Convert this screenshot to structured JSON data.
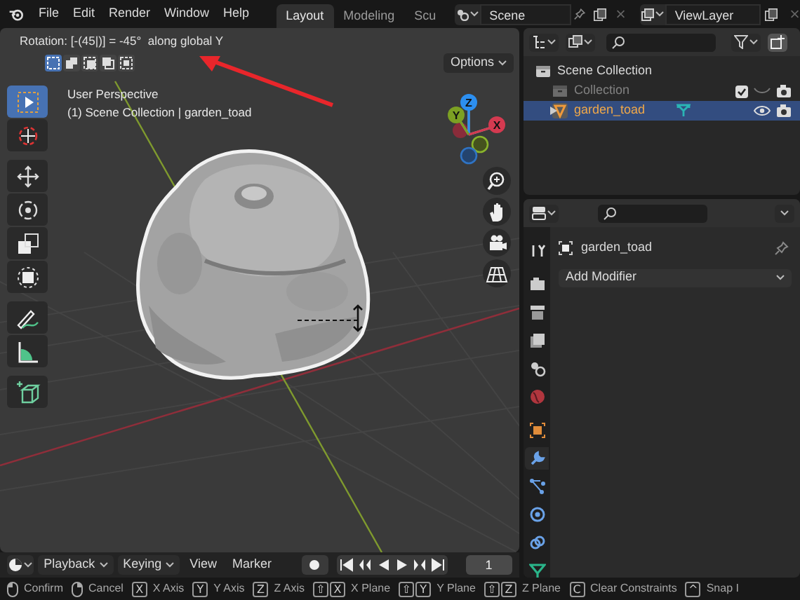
{
  "top_bar": {
    "menus": [
      "File",
      "Edit",
      "Render",
      "Window",
      "Help"
    ],
    "workspace_tabs": [
      {
        "label": "Layout",
        "selected": true
      },
      {
        "label": "Modeling",
        "selected": false
      },
      {
        "label": "Scu",
        "selected": false
      }
    ],
    "scene": "Scene",
    "view_layer": "ViewLayer"
  },
  "viewport": {
    "operator_text": "Rotation: [-(45|)] = -45°  along global Y",
    "select_modes": [
      {
        "selected": true
      },
      {
        "selected": false
      },
      {
        "selected": false
      },
      {
        "selected": false
      },
      {
        "selected": false
      }
    ],
    "options": "Options",
    "view_name": "User Perspective",
    "collection_info": "(1) Scene Collection | garden_toad",
    "tools": [
      [
        {
          "kind": "select_box",
          "selected": true
        },
        {
          "kind": "cursor",
          "selected": false
        }
      ],
      [
        {
          "kind": "move",
          "selected": false
        },
        {
          "kind": "rotate",
          "selected": false
        },
        {
          "kind": "scale",
          "selected": false
        },
        {
          "kind": "transform",
          "selected": false
        }
      ],
      [
        {
          "kind": "annotate",
          "selected": false
        },
        {
          "kind": "measure",
          "selected": false
        }
      ],
      [
        {
          "kind": "add_cube",
          "selected": false
        }
      ]
    ],
    "gizmo_axes": [
      "X",
      "Y",
      "Z"
    ]
  },
  "timeline": {
    "menus": [
      {
        "label": "Playback",
        "dropdown": true
      },
      {
        "label": "Keying",
        "dropdown": true
      },
      {
        "label": "View",
        "dropdown": false
      },
      {
        "label": "Marker",
        "dropdown": false
      }
    ],
    "current_frame": "1"
  },
  "outliner": {
    "rows": [
      {
        "label": "Scene Collection",
        "kind": "scene_collection",
        "selected": false,
        "children": [
          {
            "label": "Collection",
            "kind": "collection",
            "selected": false,
            "disabled": true,
            "checked": true,
            "visible": false
          },
          {
            "label": "garden_toad",
            "kind": "mesh_object",
            "selected": true,
            "disabled": false,
            "visible": true
          }
        ]
      }
    ]
  },
  "properties": {
    "tabs": [
      {
        "kind": "tool",
        "selected": false
      },
      {
        "kind": "render",
        "selected": false
      },
      {
        "kind": "output",
        "selected": false
      },
      {
        "kind": "view_layer",
        "selected": false
      },
      {
        "kind": "scene",
        "selected": false
      },
      {
        "kind": "world",
        "selected": false
      },
      {
        "kind": "object",
        "selected": false
      },
      {
        "kind": "modifier",
        "selected": true
      },
      {
        "kind": "particles",
        "selected": false
      },
      {
        "kind": "physics",
        "selected": false
      },
      {
        "kind": "constraints",
        "selected": false
      },
      {
        "kind": "data",
        "selected": false
      }
    ],
    "object_name": "garden_toad",
    "add_modifier": "Add Modifier"
  },
  "status_bar": [
    {
      "kind": "mouse_left",
      "label": "Confirm"
    },
    {
      "kind": "mouse_right",
      "label": "Cancel"
    },
    {
      "kind": "keys",
      "keys": [
        "X"
      ],
      "label": "X Axis"
    },
    {
      "kind": "keys",
      "keys": [
        "Y"
      ],
      "label": "Y Axis"
    },
    {
      "kind": "keys",
      "keys": [
        "Z"
      ],
      "label": "Z Axis"
    },
    {
      "kind": "keys",
      "keys": [
        "⇧",
        "X"
      ],
      "label": "X Plane"
    },
    {
      "kind": "keys",
      "keys": [
        "⇧",
        "Y"
      ],
      "label": "Y Plane"
    },
    {
      "kind": "keys",
      "keys": [
        "⇧",
        "Z"
      ],
      "label": "Z Plane"
    },
    {
      "kind": "keys",
      "keys": [
        "C"
      ],
      "label": "Clear Constraints"
    },
    {
      "kind": "keys",
      "keys": [
        "^"
      ],
      "label": "Snap I"
    }
  ]
}
